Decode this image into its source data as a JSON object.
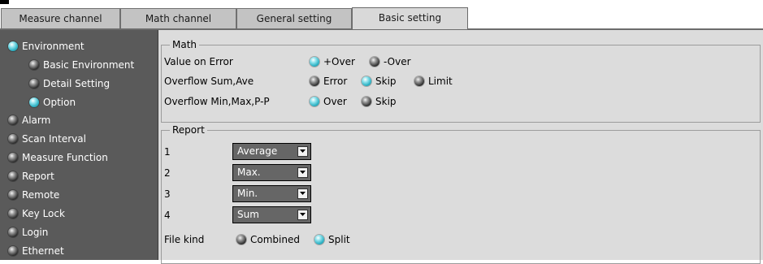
{
  "tabs": [
    {
      "label": "Measure channel",
      "active": false
    },
    {
      "label": "Math channel",
      "active": false
    },
    {
      "label": "General setting",
      "active": false
    },
    {
      "label": "Basic setting",
      "active": true
    }
  ],
  "sidebar": {
    "items": [
      {
        "label": "Environment",
        "selected": true,
        "level": 0
      },
      {
        "label": "Basic Environment",
        "selected": false,
        "level": 1
      },
      {
        "label": "Detail Setting",
        "selected": false,
        "level": 1
      },
      {
        "label": "Option",
        "selected": true,
        "level": 1
      },
      {
        "label": "Alarm",
        "selected": false,
        "level": 0
      },
      {
        "label": "Scan Interval",
        "selected": false,
        "level": 0
      },
      {
        "label": "Measure Function",
        "selected": false,
        "level": 0
      },
      {
        "label": "Report",
        "selected": false,
        "level": 0
      },
      {
        "label": "Remote",
        "selected": false,
        "level": 0
      },
      {
        "label": "Key Lock",
        "selected": false,
        "level": 0
      },
      {
        "label": "Login",
        "selected": false,
        "level": 0
      },
      {
        "label": "Ethernet",
        "selected": false,
        "level": 0
      }
    ]
  },
  "math": {
    "title": "Math",
    "rows": [
      {
        "label": "Value on Error",
        "options": [
          {
            "label": "+Over",
            "on": true
          },
          {
            "label": "-Over",
            "on": false
          }
        ]
      },
      {
        "label": "Overflow Sum,Ave",
        "options": [
          {
            "label": "Error",
            "on": false
          },
          {
            "label": "Skip",
            "on": true
          },
          {
            "label": "Limit",
            "on": false
          }
        ]
      },
      {
        "label": "Overflow Min,Max,P-P",
        "options": [
          {
            "label": "Over",
            "on": true
          },
          {
            "label": "Skip",
            "on": false
          }
        ]
      }
    ]
  },
  "report": {
    "title": "Report",
    "rows": [
      {
        "label": "1",
        "value": "Average"
      },
      {
        "label": "2",
        "value": "Max."
      },
      {
        "label": "3",
        "value": "Min."
      },
      {
        "label": "4",
        "value": "Sum"
      }
    ],
    "file_kind": {
      "label": "File kind",
      "options": [
        {
          "label": "Combined",
          "on": false
        },
        {
          "label": "Split",
          "on": true
        }
      ]
    }
  },
  "colors": {
    "sidebar_bg": "#5a5a5a",
    "panel_bg": "#dcdcdc",
    "radio_on": "#2fb2c4",
    "radio_off": "#303030",
    "select_bg": "#666666"
  }
}
